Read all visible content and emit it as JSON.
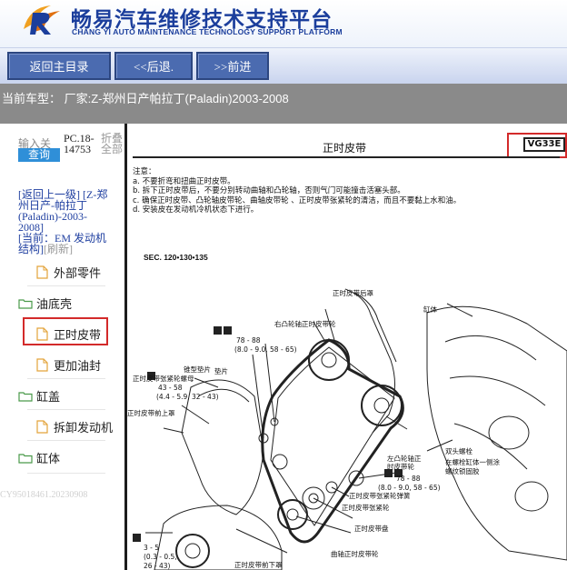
{
  "header": {
    "title_cn": "畅易汽车维修技术支持平台",
    "title_en": "CHANG YI AUTO MAINTENANCE TECHNOLOGY SUPPORT PLATFORM",
    "brand_color": "#1b3e9c"
  },
  "nav": {
    "home_label": "返回主目录",
    "back_label": "<<后退.",
    "forward_label": ">>前进"
  },
  "car_bar": {
    "text": "当前车型：  厂家:Z-郑州日产帕拉丁(Paladin)2003-2008"
  },
  "sidebar": {
    "search_label": "输入关",
    "search_button": "查询",
    "pc_code": "PC.18-14753",
    "fold_label": "折叠全部",
    "back_up_link": "[返回上一级]  [Z-郑州日产-帕拉丁(Paladin)-2003-2008]",
    "current_prefix": "[当前：",
    "current_value": "EM 发动机结构]",
    "refresh": "[刷新]",
    "items": [
      {
        "label": "外部零件",
        "type": "doc"
      },
      {
        "label": "油底壳",
        "type": "folder"
      },
      {
        "label": "正时皮带",
        "type": "doc",
        "selected": true
      },
      {
        "label": "更加油封",
        "type": "doc"
      },
      {
        "label": "缸盖",
        "type": "folder"
      },
      {
        "label": "拆卸发动机",
        "type": "doc"
      },
      {
        "label": "缸体",
        "type": "folder"
      }
    ],
    "watermark": "CY95018461.20230908"
  },
  "document": {
    "title": "正时皮带",
    "code": "VG33E",
    "notes_header": "注意：",
    "notes": [
      "a.  不要折弯和扭曲正时皮带。",
      "b.  拆下正时皮带后，不要分别转动曲轴和凸轮轴，否则气门可能撞击活塞头部。",
      "c.  确保正时皮带、凸轮轴皮带轮、曲轴皮带轮 、正时皮带张紧轮的清洁，而且不要黏上水和油。",
      "d.  安装皮在发动机冷机状态下进行。"
    ],
    "sec": "SEC. 120•130•135",
    "labels": {
      "rear_cover": "正时皮带后罩",
      "right_cam": "右凸轮轴正时皮带轮",
      "block": "缸体",
      "torque1": "78 - 88",
      "torque1b": "(8.0 - 9.0, 58 - 65)",
      "guide_pad": "锥型垫片",
      "pad": "垫片",
      "tensioner_bolt": "正时皮带张紧轮螺母",
      "torque2": "43 - 58",
      "torque2b": "(4.4 - 5.9, 32 - 43)",
      "front_upper": "正时皮带前上罩",
      "left_cam": "左凸轮轴正",
      "left_cam2": "时皮带轮",
      "stud": "双头螺栓",
      "stud_note1": "在螺栓缸体一侧涂",
      "stud_note2": "螺纹锁固胶",
      "torque3": "78 - 88",
      "torque3b": "(8.0 - 9.0, 58 - 65)",
      "tensioner_spring": "正时皮带张紧轮弹簧",
      "tensioner": "正时皮带张紧轮",
      "belt_plate": "正时皮带盘",
      "crank_pulley": "曲轴正时皮带轮",
      "torque4": "3 - 5",
      "torque4b": "(0.3 - 0.5,",
      "torque4c": "26 - 43)",
      "front_lower": "正时皮带前下罩"
    }
  }
}
